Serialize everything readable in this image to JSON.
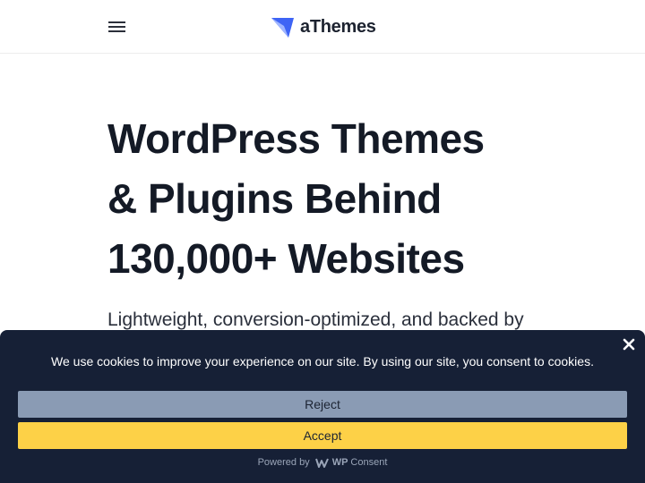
{
  "header": {
    "brand_name": "aThemes",
    "menu_icon": "hamburger-menu-icon",
    "logo_icon": "athemes-logo-icon",
    "logo_color": "#3e64f5"
  },
  "hero": {
    "title_lines": [
      "WordPress Themes",
      "& Plugins Behind",
      "130,000+ Websites"
    ],
    "subtitle": "Lightweight, conversion-optimized, and backed by"
  },
  "cookie_banner": {
    "message": "We use cookies to improve your experience on our site. By using our site, you consent to cookies.",
    "reject_label": "Reject",
    "accept_label": "Accept",
    "powered_by": "Powered by",
    "provider_bold": "WP",
    "provider_rest": "Consent",
    "close_icon": "close-icon",
    "colors": {
      "background": "#162036",
      "reject": "#8a9bb4",
      "accept": "#fdd147"
    }
  }
}
